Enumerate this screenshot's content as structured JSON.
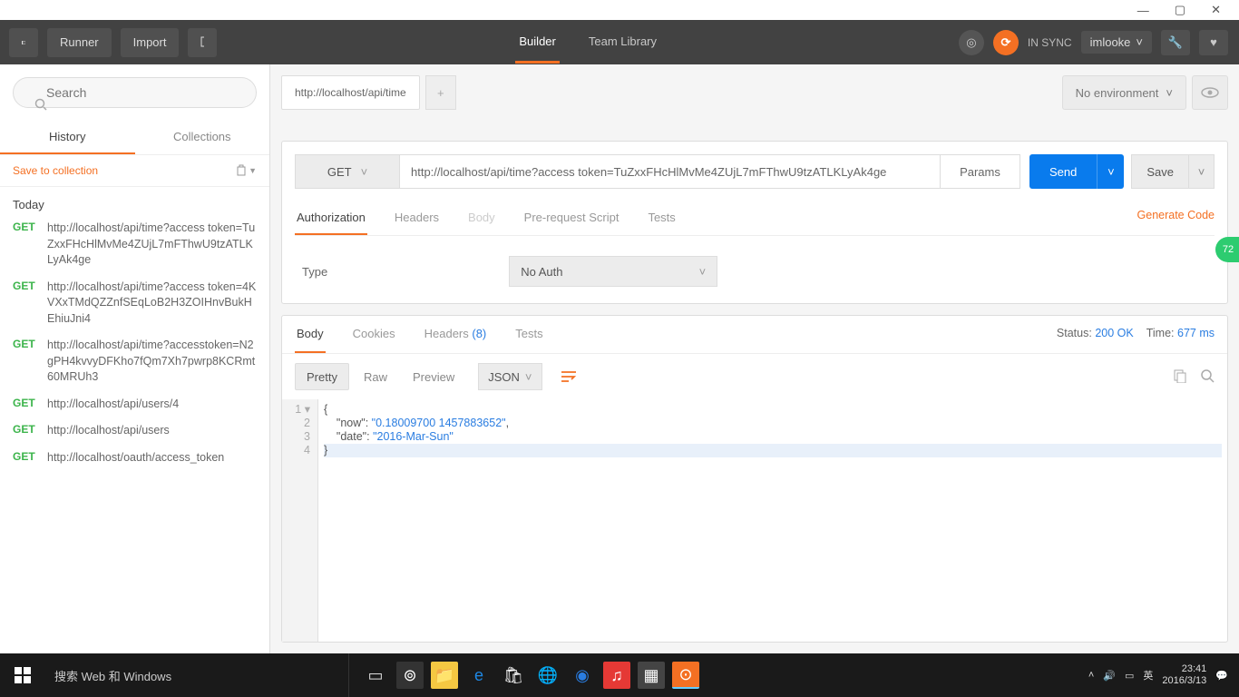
{
  "window": {
    "min": "—",
    "max": "▢",
    "close": "✕"
  },
  "topbar": {
    "runner": "Runner",
    "import": "Import",
    "builder": "Builder",
    "teamlib": "Team Library",
    "sync": "IN SYNC",
    "user": "imlooke"
  },
  "sidebar": {
    "search_ph": "Search",
    "tab_history": "History",
    "tab_collections": "Collections",
    "save_collection": "Save to collection",
    "today": "Today",
    "items": [
      {
        "m": "GET",
        "u": "http://localhost/api/time?access token=TuZxxFHcHlMvMe4ZUjL7mFThwU9tzATLKLyAk4ge"
      },
      {
        "m": "GET",
        "u": "http://localhost/api/time?access token=4KVXxTMdQZZnfSEqLoB2H3ZOIHnvBukHEhiuJni4"
      },
      {
        "m": "GET",
        "u": "http://localhost/api/time?accesstoken=N2gPH4kvvyDFKho7fQm7Xh7pwrp8KCRmt60MRUh3"
      },
      {
        "m": "GET",
        "u": "http://localhost/api/users/4"
      },
      {
        "m": "GET",
        "u": "http://localhost/api/users"
      },
      {
        "m": "GET",
        "u": "http://localhost/oauth/access_token"
      }
    ]
  },
  "env": "No environment",
  "request": {
    "tab_title": "http://localhost/api/time",
    "method": "GET",
    "url": "http://localhost/api/time?access token=TuZxxFHcHlMvMe4ZUjL7mFThwU9tzATLKLyAk4ge",
    "params": "Params",
    "send": "Send",
    "save": "Save",
    "tabs": {
      "auth": "Authorization",
      "headers": "Headers",
      "body": "Body",
      "prereq": "Pre-request Script",
      "tests": "Tests"
    },
    "gen": "Generate Code",
    "auth_label": "Type",
    "auth_value": "No Auth"
  },
  "response": {
    "tabs": {
      "body": "Body",
      "cookies": "Cookies",
      "headers": "Headers",
      "headers_count": "(8)",
      "tests": "Tests"
    },
    "status_lbl": "Status:",
    "status_val": "200 OK",
    "time_lbl": "Time:",
    "time_val": "677 ms",
    "views": {
      "pretty": "Pretty",
      "raw": "Raw",
      "preview": "Preview",
      "json": "JSON"
    },
    "lines": [
      "{",
      "    \"now\": \"0.18009700 1457883652\",",
      "    \"date\": \"2016-Mar-Sun\"",
      "}"
    ]
  },
  "taskbar": {
    "search": "搜索 Web 和 Windows",
    "time": "23:41",
    "date": "2016/3/13"
  },
  "badge": "72"
}
